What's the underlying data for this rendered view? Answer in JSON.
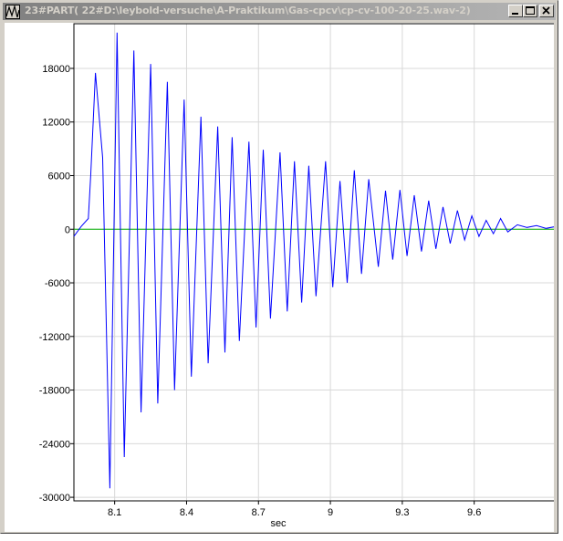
{
  "window": {
    "title": "23#PART( 22#D:\\leybold-versuche\\A-Praktikum\\Gas-cpcv\\cp-cv-100-20-25.wav-2)",
    "icons": {
      "app": "waveform-app-icon",
      "minimize": "minimize-icon",
      "maximize": "maximize-icon",
      "close": "close-icon"
    }
  },
  "colors": {
    "titlebar_start": "#808080",
    "titlebar_end": "#b5b5b5",
    "signal": "#0000ff",
    "zero_line": "#00b000",
    "frame": "#d4d0c8"
  },
  "chart_data": {
    "type": "line",
    "title": "",
    "xlabel": "sec",
    "ylabel": "",
    "xlim": [
      7.93,
      9.94
    ],
    "ylim": [
      -30400,
      23000
    ],
    "xticks": [
      8.1,
      8.4,
      8.7,
      9,
      9.3,
      9.6
    ],
    "xtick_labels": [
      "8.1",
      "8.4",
      "8.7",
      "9",
      "9.3",
      "9.6"
    ],
    "yticks": [
      18000,
      12000,
      6000,
      0,
      -6000,
      -12000,
      -18000,
      -24000,
      -30000
    ],
    "ytick_labels": [
      "18000",
      "12000",
      "6000",
      "0",
      "-6000",
      "-12000",
      "-18000",
      "-24000",
      "-30000"
    ],
    "grid": true,
    "legend": "none",
    "series": [
      {
        "x": [
          7.93,
          7.96,
          7.99,
          8.0,
          8.02,
          8.05,
          8.08,
          8.11,
          8.14,
          8.18,
          8.21,
          8.25,
          8.28,
          8.32,
          8.35,
          8.39,
          8.42,
          8.46,
          8.49,
          8.53,
          8.56,
          8.59,
          8.62,
          8.66,
          8.69,
          8.72,
          8.75,
          8.79,
          8.82,
          8.85,
          8.88,
          8.91,
          8.94,
          8.98,
          9.01,
          9.04,
          9.07,
          9.1,
          9.13,
          9.16,
          9.2,
          9.23,
          9.26,
          9.29,
          9.32,
          9.35,
          9.38,
          9.41,
          9.44,
          9.47,
          9.5,
          9.53,
          9.56,
          9.59,
          9.62,
          9.65,
          9.68,
          9.71,
          9.74,
          9.78,
          9.82,
          9.86,
          9.9,
          9.94
        ],
        "y": [
          -800,
          300,
          1200,
          6000,
          17500,
          8000,
          -29000,
          22000,
          -25500,
          20000,
          -20500,
          18500,
          -19500,
          16500,
          -18000,
          14500,
          -16500,
          12600,
          -15000,
          11500,
          -13800,
          10300,
          -12500,
          9800,
          -11000,
          8900,
          -10000,
          8600,
          -9200,
          7600,
          -8200,
          7100,
          -7500,
          7600,
          -6500,
          5400,
          -6000,
          6600,
          -5000,
          5600,
          -4200,
          4300,
          -3400,
          4400,
          -3000,
          3800,
          -2500,
          3200,
          -2200,
          2500,
          -1600,
          2100,
          -1200,
          1500,
          -800,
          1000,
          -500,
          1200,
          -300,
          500,
          200,
          400,
          100,
          300
        ]
      }
    ],
    "baseline": 0
  }
}
